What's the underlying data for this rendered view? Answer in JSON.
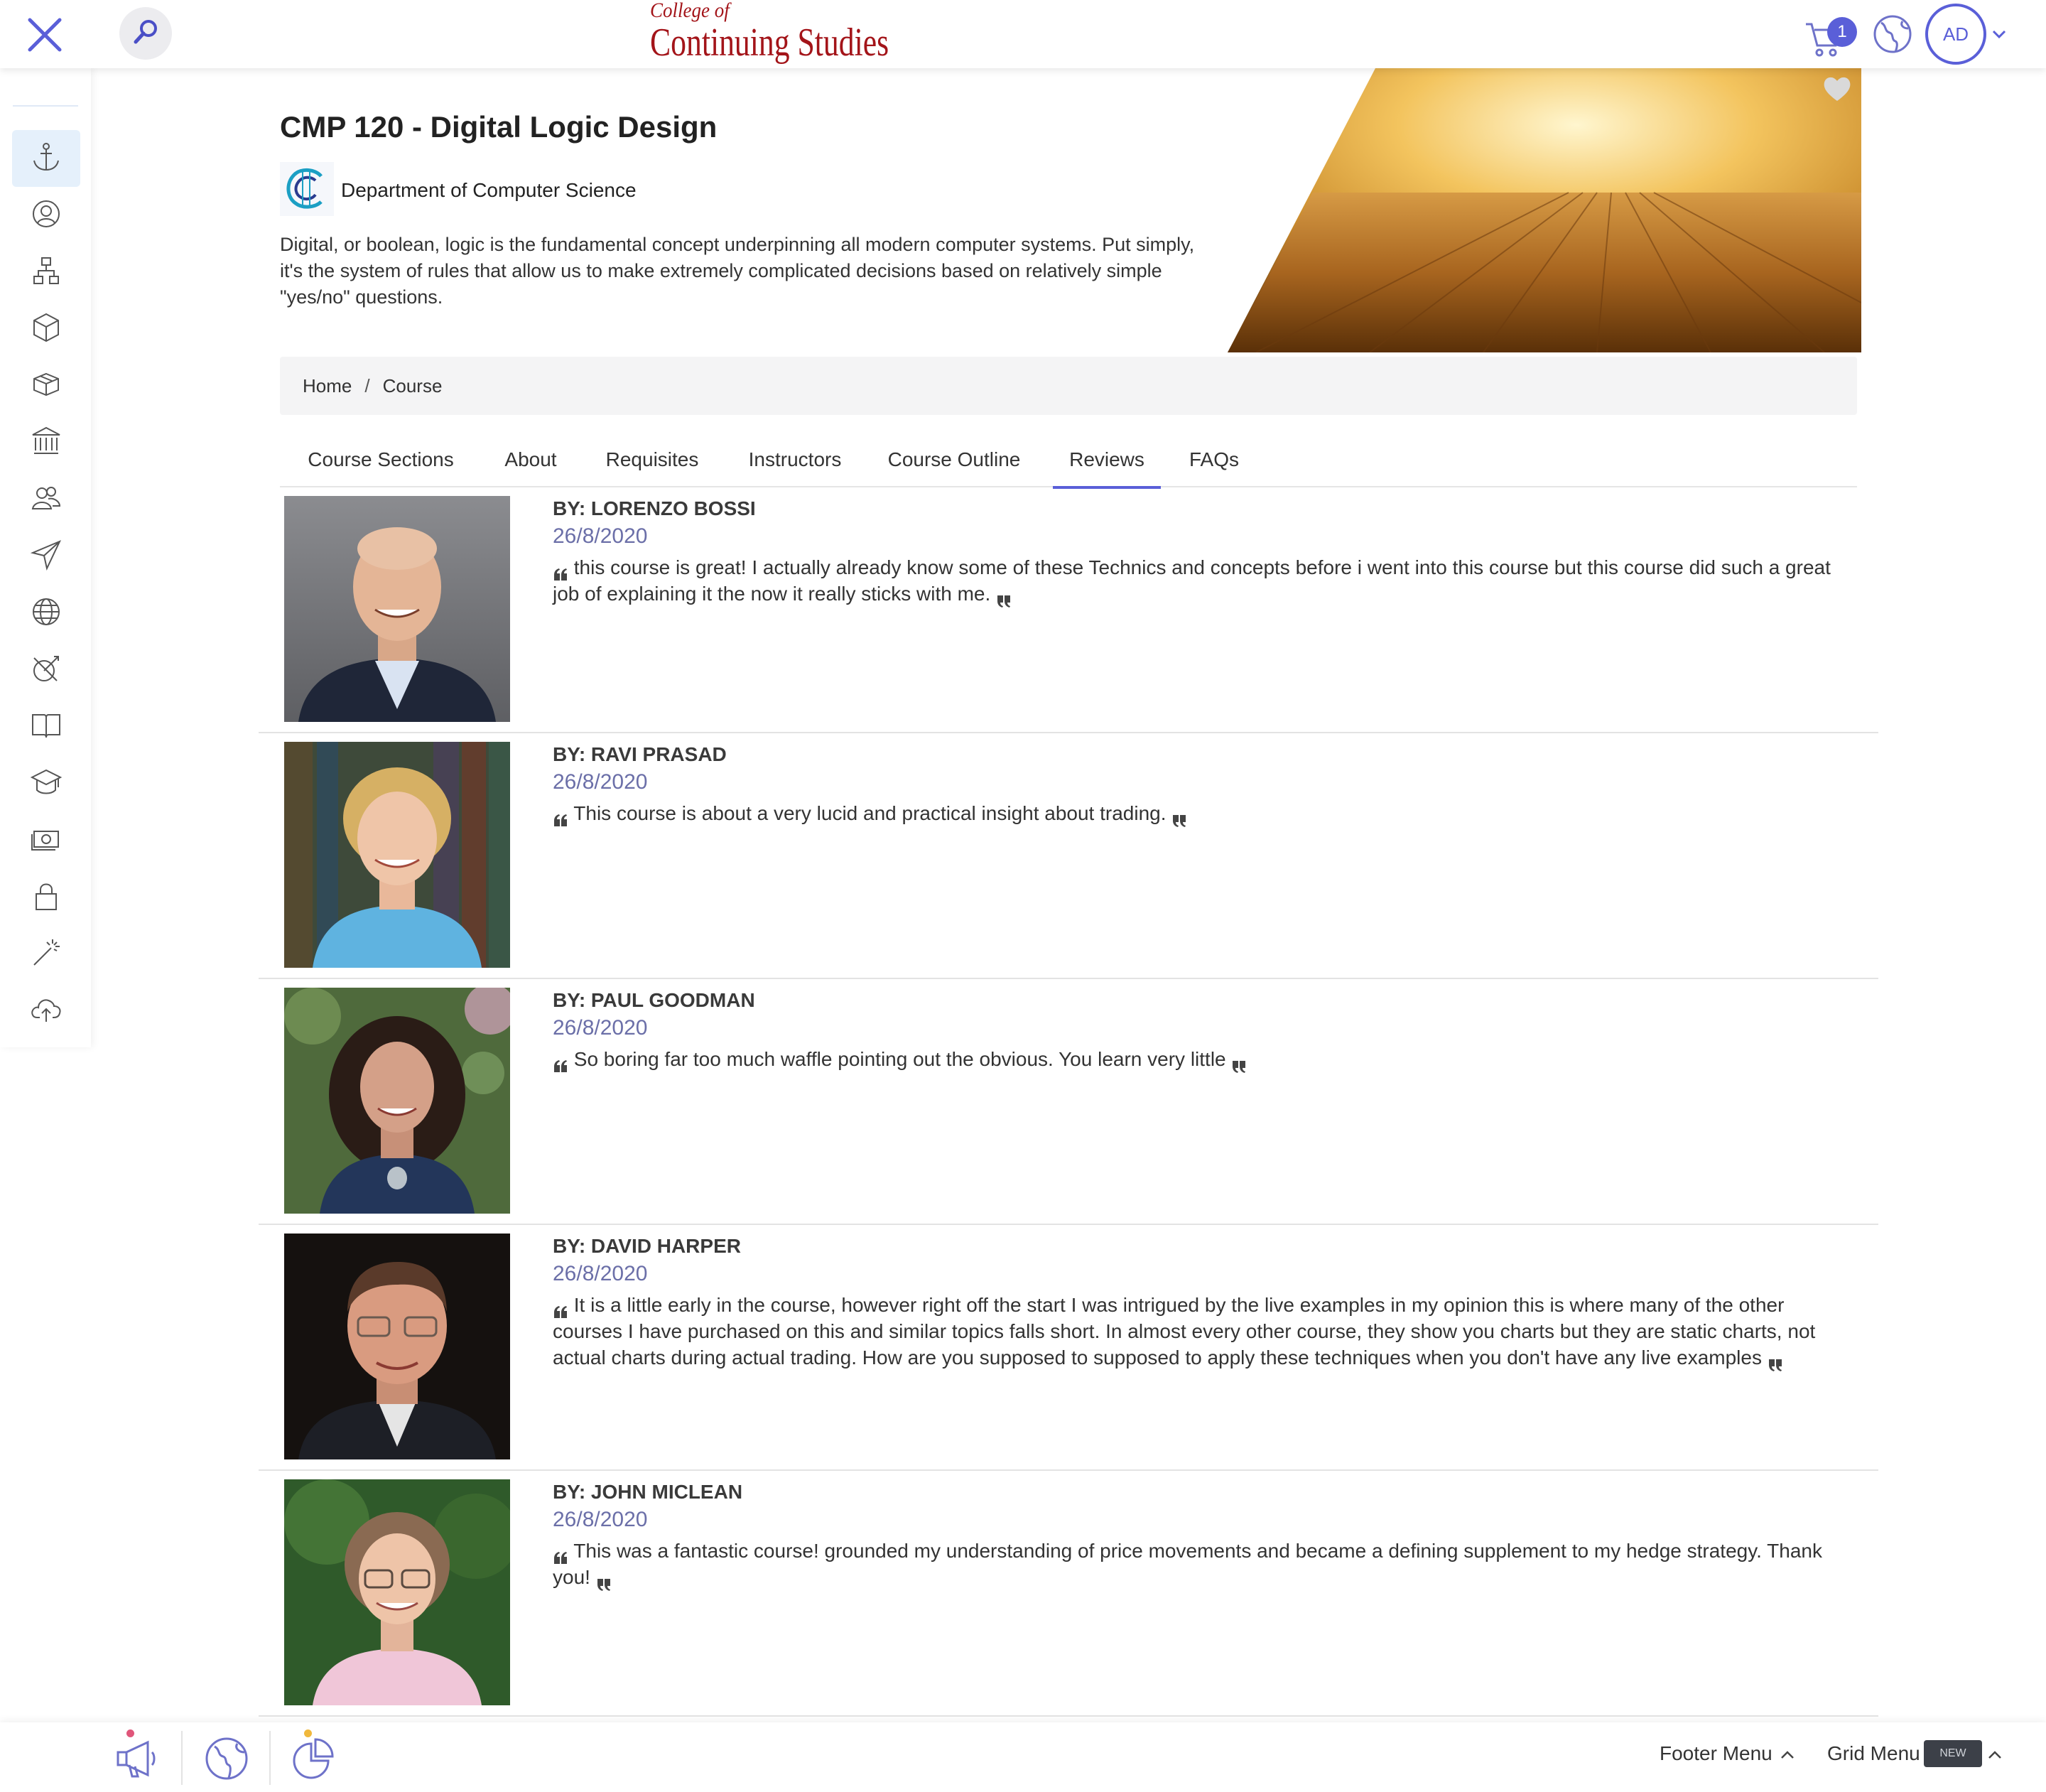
{
  "header": {
    "close_icon": "close-icon",
    "search_icon": "search-icon",
    "brand_line1": "College of",
    "brand_line2": "Continuing Studies",
    "cart_count": "1",
    "avatar_initials": "AD",
    "colors": {
      "accent": "#5a5fd8",
      "brand": "#a31419"
    }
  },
  "sidebar": {
    "items": [
      {
        "icon": "anchor-icon",
        "active": true
      },
      {
        "icon": "user-circle-icon"
      },
      {
        "icon": "org-chart-icon"
      },
      {
        "icon": "cube-icon"
      },
      {
        "icon": "boxes-icon"
      },
      {
        "icon": "institution-icon"
      },
      {
        "icon": "users-icon"
      },
      {
        "icon": "paper-plane-icon"
      },
      {
        "icon": "globe-icon"
      },
      {
        "icon": "target-icon"
      },
      {
        "icon": "book-icon"
      },
      {
        "icon": "graduation-cap-icon"
      },
      {
        "icon": "money-icon"
      },
      {
        "icon": "lock-icon"
      },
      {
        "icon": "magic-wand-icon"
      },
      {
        "icon": "cloud-upload-icon"
      }
    ]
  },
  "course": {
    "title": "CMP 120 - Digital Logic Design",
    "department": "Department of Computer Science",
    "description": "Digital, or boolean, logic is the fundamental concept underpinning all modern computer systems. Put simply, it's the system of rules that allow us to make extremely complicated decisions based on relatively simple \"yes/no\" questions."
  },
  "breadcrumb": {
    "home": "Home",
    "separator": "/",
    "current": "Course"
  },
  "tabs": [
    {
      "label": "Course Sections"
    },
    {
      "label": "About"
    },
    {
      "label": "Requisites"
    },
    {
      "label": "Instructors"
    },
    {
      "label": "Course Outline"
    },
    {
      "label": "Reviews",
      "active": true
    },
    {
      "label": "FAQs"
    }
  ],
  "reviews": [
    {
      "author": "BY: LORENZO BOSSI",
      "date": "26/8/2020",
      "text": "this course is great! I actually already know some of these Technics and concepts before i went into this course but this course did such a great job of explaining it the now it really sticks with me."
    },
    {
      "author": "BY: RAVI PRASAD",
      "date": "26/8/2020",
      "text": "This course is about a very lucid and practical insight about trading."
    },
    {
      "author": "BY: PAUL GOODMAN",
      "date": "26/8/2020",
      "text": "So boring far too much waffle pointing out the obvious. You learn very little"
    },
    {
      "author": "BY: DAVID HARPER",
      "date": "26/8/2020",
      "text": "It is a little early in the course, however right off the start I was intrigued by the live examples in my opinion this is where many of the other courses I have purchased on this and similar topics falls short. In almost every other course, they show you charts but they are static charts, not actual charts during actual trading. How are you supposed to supposed to apply these techniques when you don't have any live examples"
    },
    {
      "author": "BY: JOHN MICLEAN",
      "date": "26/8/2020",
      "text": "This was a fantastic course! grounded my understanding of price movements and became a defining supplement to my hedge strategy. Thank you!"
    }
  ],
  "footer": {
    "icons": [
      "megaphone-icon",
      "globe-icon",
      "pie-chart-icon"
    ],
    "footer_menu": "Footer Menu",
    "grid_menu": "Grid Menu",
    "new_badge": "NEW"
  }
}
